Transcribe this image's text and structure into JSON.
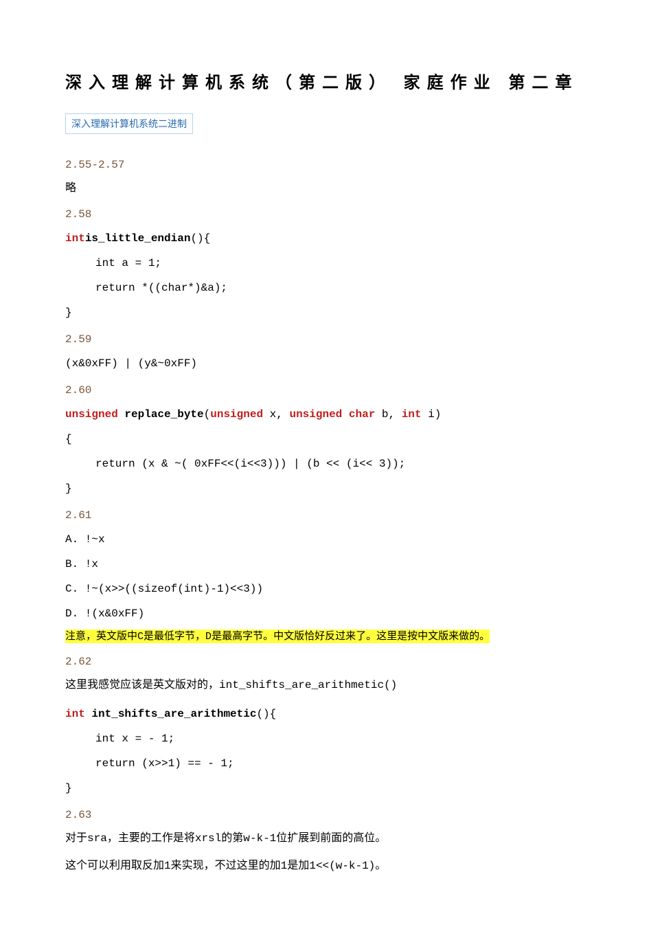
{
  "title": "深入理解计算机系统（第二版） 家庭作业 第二章",
  "tag": "深入理解计算机系统二进制",
  "s255_257": {
    "num": "2.55-2.57",
    "text": "略"
  },
  "s258": {
    "num": "2.58",
    "code": {
      "l1_kw": "int",
      "l1_fn": "is_little_endian",
      "l1_tail": "(){",
      "l2_kw": "int",
      "l2_tail": " a = 1;",
      "l3_a": "return *((",
      "l3_kw": "char",
      "l3_b": "*)&a);",
      "l4": "}"
    }
  },
  "s259": {
    "num": "2.59",
    "expr": "(x&0xFF) | (y&~0xFF)"
  },
  "s260": {
    "num": "2.60",
    "sig": {
      "kw1": "unsigned",
      "fn": " replace_byte",
      "a": "(",
      "kw2": "unsigned",
      "b": " x, ",
      "kw3": "unsigned",
      "c": " ",
      "kw4": "char",
      "d": " b, ",
      "kw5": "int",
      "e": " i)"
    },
    "l2": "{",
    "l3": "return (x & ~( 0xFF<<(i<<3))) | (b << (i<< 3));",
    "l4": "}"
  },
  "s261": {
    "num": "2.61",
    "A": "A. !~x",
    "B": "B. !x",
    "C": "C. !~(x>>((sizeof(int)-1)<<3))",
    "D": "D. !(x&0xFF)",
    "note_a": "注意，英文版中",
    "note_C": "C",
    "note_b": "是最低字节，",
    "note_D": "D",
    "note_c": "是最高字节。中文版恰好反过来了。这里是按中文版来做的。"
  },
  "s262": {
    "num": "2.62",
    "intro_a": "这里我感觉应该是英文版对的，",
    "intro_b": "int_shifts_are_arithmetic()",
    "code": {
      "l1_kw": "int",
      "l1_fn": " int_shifts_are_arithmetic",
      "l1_tail": "(){",
      "l2_kw": "int",
      "l2_tail": " x = - 1;",
      "l3": "return (x>>1) == - 1;",
      "l4": "}"
    }
  },
  "s263": {
    "num": "2.63",
    "p1_a": "对于",
    "p1_b": "sra",
    "p1_c": "，主要的工作是将",
    "p1_d": "xrsl",
    "p1_e": "的第",
    "p1_f": "w-k-1",
    "p1_g": "位扩展到前面的高位。",
    "p2_a": "这个可以利用取反加",
    "p2_b": "1",
    "p2_c": "来实现，不过这里的加",
    "p2_d": "1",
    "p2_e": "是加",
    "p2_f": "1<<(w-k-1)",
    "p2_g": "。"
  }
}
